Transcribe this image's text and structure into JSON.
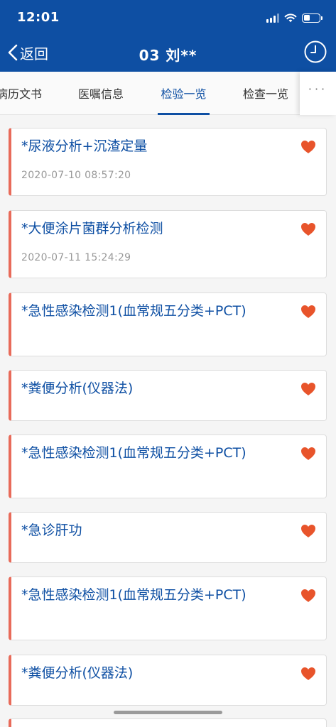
{
  "status_bar": {
    "time": "12:01"
  },
  "nav": {
    "back_label": "返回",
    "title": "03 刘**"
  },
  "tabs": [
    {
      "label": "病历文书"
    },
    {
      "label": "医嘱信息"
    },
    {
      "label": "检验一览",
      "active": true
    },
    {
      "label": "检查一览"
    }
  ],
  "more_label": "···",
  "items": [
    {
      "name": "*尿液分析+沉渣定量",
      "date": "2020-07-10 08:57:20"
    },
    {
      "name": "*大便涂片菌群分析检测",
      "date": "2020-07-11 15:24:29"
    },
    {
      "name": "*急性感染检测1(血常规五分类+PCT)",
      "date": ""
    },
    {
      "name": "*粪便分析(仪器法)",
      "date": ""
    },
    {
      "name": "*急性感染检测1(血常规五分类+PCT)",
      "date": ""
    },
    {
      "name": "*急诊肝功",
      "date": ""
    },
    {
      "name": "*急性感染检测1(血常规五分类+PCT)",
      "date": ""
    },
    {
      "name": "*粪便分析(仪器法)",
      "date": ""
    }
  ],
  "colors": {
    "brand": "#0e4fa3",
    "accent": "#e86b5a",
    "heart": "#e8542b"
  }
}
